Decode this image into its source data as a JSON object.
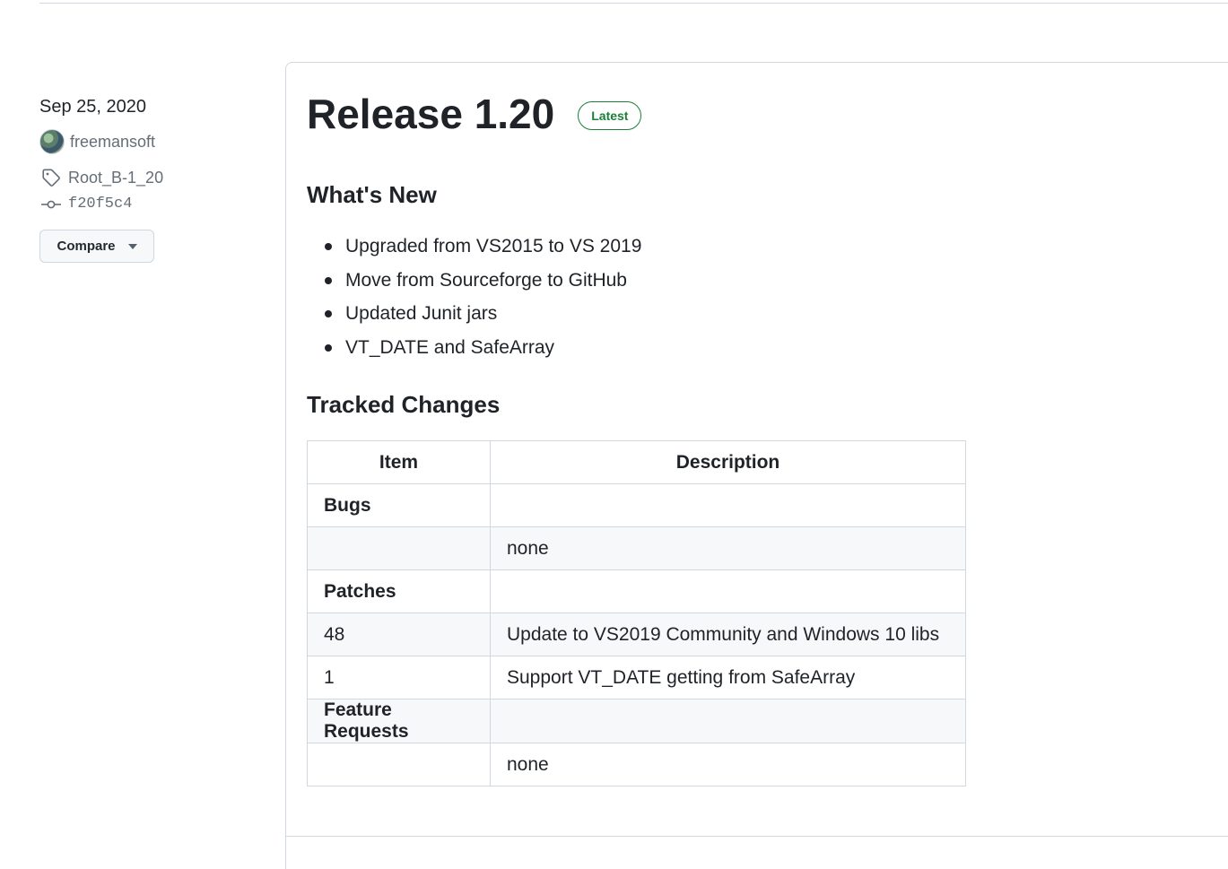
{
  "sidebar": {
    "date": "Sep 25, 2020",
    "author": "freemansoft",
    "tag": "Root_B-1_20",
    "commit": "f20f5c4",
    "compare_label": "Compare"
  },
  "release": {
    "title": "Release 1.20",
    "badge": "Latest",
    "whats_new_heading": "What's New",
    "whats_new_items": [
      "Upgraded from VS2015 to VS 2019",
      "Move from Sourceforge to GitHub",
      "Updated Junit jars",
      "VT_DATE and SafeArray"
    ],
    "tracked_heading": "Tracked Changes",
    "table": {
      "headers": [
        "Item",
        "Description"
      ],
      "rows": [
        {
          "item": "Bugs",
          "desc": ""
        },
        {
          "item": "",
          "desc": "none"
        },
        {
          "item": "Patches",
          "desc": ""
        },
        {
          "item": "48",
          "desc": "Update to VS2019 Community and Windows 10 libs"
        },
        {
          "item": "1",
          "desc": "Support VT_DATE getting from SafeArray"
        },
        {
          "item": "Feature Requests",
          "desc": ""
        },
        {
          "item": "",
          "desc": "none"
        }
      ]
    }
  },
  "icons": {
    "tag": "tag-icon",
    "commit": "git-commit-icon",
    "caret": "triangle-down-icon"
  },
  "colors": {
    "badge_green": "#1a7f37",
    "muted_text": "#656d76",
    "border": "#d0d7de",
    "row_alt": "#f6f8fa"
  }
}
